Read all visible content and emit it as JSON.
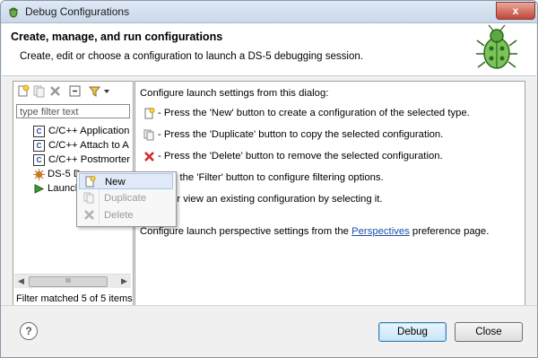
{
  "window": {
    "title": "Debug Configurations",
    "close_label": "x"
  },
  "banner": {
    "heading": "Create, manage, and run configurations",
    "subtitle": "Create, edit or choose a configuration to launch a DS-5 debugging session."
  },
  "left_panel": {
    "toolbar_icons": [
      "new-config-icon",
      "duplicate-icon",
      "delete-icon",
      "collapse-all-icon",
      "filter-icon",
      "dropdown-arrow-icon"
    ],
    "filter_placeholder": "type filter text",
    "tree_items": [
      {
        "label": "C/C++ Application",
        "icon": "c-config-icon"
      },
      {
        "label": "C/C++ Attach to A",
        "icon": "c-config-icon"
      },
      {
        "label": "C/C++ Postmorter",
        "icon": "c-config-icon"
      },
      {
        "label": "DS-5 D",
        "icon": "ds5-config-icon"
      },
      {
        "label": "Launch",
        "icon": "launch-group-icon"
      }
    ],
    "scroll_thumb_label": "III",
    "status": "Filter matched 5 of 5 items"
  },
  "right_panel": {
    "intro": "Configure launch settings from this dialog:",
    "lines": [
      {
        "icon": "new-config-icon",
        "text": "- Press the 'New' button to create a configuration of the selected type."
      },
      {
        "icon": "duplicate-icon",
        "text": "- Press the 'Duplicate' button to copy the selected configuration."
      },
      {
        "icon": "delete-icon",
        "text": "- Press the 'Delete' button to remove the selected configuration."
      },
      {
        "icon": "filter-icon",
        "text": "ress the 'Filter' button to configure filtering options."
      },
      {
        "icon": "edit-icon",
        "text": "dit or view an existing configuration by selecting it."
      }
    ],
    "perspectives_before": "Configure launch perspective settings from the ",
    "perspectives_link": "Perspectives",
    "perspectives_after": " preference page."
  },
  "context_menu": {
    "items": [
      {
        "label": "New",
        "icon": "new-config-icon",
        "enabled": true,
        "selected": true
      },
      {
        "label": "Duplicate",
        "icon": "duplicate-icon",
        "enabled": false,
        "selected": false
      },
      {
        "label": "Delete",
        "icon": "delete-icon",
        "enabled": false,
        "selected": false
      }
    ]
  },
  "footer": {
    "help_label": "?",
    "debug_label": "Debug",
    "close_label": "Close"
  }
}
